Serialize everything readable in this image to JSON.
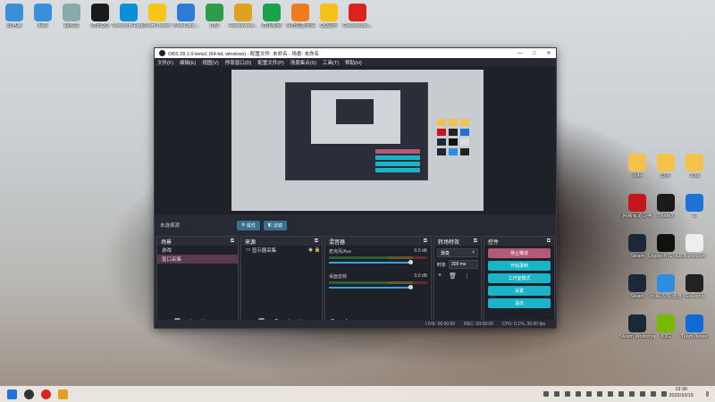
{
  "desktop_icons": [
    {
      "label": "此电脑",
      "icon": "pc-icon",
      "color": "#3a8fd9"
    },
    {
      "label": "网络",
      "icon": "network-icon",
      "color": "#3a8fd9"
    },
    {
      "label": "回收站",
      "icon": "recycle-bin-icon",
      "color": "#8aa"
    },
    {
      "label": "腾讯QQ",
      "icon": "qq-icon",
      "color": "#1b1b1b"
    },
    {
      "label": "Microsoft Edge",
      "icon": "edge-icon",
      "color": "#0c8fd8"
    },
    {
      "label": "TeamViewer",
      "icon": "teamviewer-icon",
      "color": "#f5c518"
    },
    {
      "label": "WiseCare...",
      "icon": "wisecare-icon",
      "color": "#2d7bd6"
    },
    {
      "label": "IDM",
      "icon": "idm-icon",
      "color": "#2e9b4a"
    },
    {
      "label": "Honeyview...",
      "icon": "honeyview-icon",
      "color": "#e0a020"
    },
    {
      "label": "腾讯视频",
      "icon": "tencent-video-icon",
      "color": "#1aa34a"
    },
    {
      "label": "斗鱼直播伴侣",
      "icon": "douyu-icon",
      "color": "#f07a1e"
    },
    {
      "label": "QQ音乐",
      "icon": "qq-music-icon",
      "color": "#f2c21b"
    },
    {
      "label": "CloudMusic...",
      "icon": "cloudmusic-icon",
      "color": "#d8231f"
    }
  ],
  "right_icons": [
    {
      "label": "资料",
      "icon": "folder-icon",
      "color": "#f3c24a"
    },
    {
      "label": "软件",
      "icon": "folder-icon",
      "color": "#f3c24a"
    },
    {
      "label": "文档",
      "icon": "folder-icon",
      "color": "#f3c24a"
    },
    {
      "label": "网易有道词典",
      "icon": "youdao-icon",
      "color": "#c4161c"
    },
    {
      "label": "ShareX",
      "icon": "sharex-icon",
      "color": "#1b1b1b"
    },
    {
      "label": "S",
      "icon": "sogou-icon",
      "color": "#1d73d8"
    },
    {
      "label": "Steam",
      "icon": "steam-icon",
      "color": "#1b2838"
    },
    {
      "label": "Logitech G HUB",
      "icon": "ghub-icon",
      "color": "#111"
    },
    {
      "label": "Bandicam",
      "icon": "bandicam-icon",
      "color": "#eee"
    },
    {
      "label": "Steam",
      "icon": "steam-icon",
      "color": "#1b2838"
    },
    {
      "label": "网易UU加速器",
      "icon": "uu-icon",
      "color": "#2d8de0"
    },
    {
      "label": "GeForce",
      "icon": "geforce-icon",
      "color": "#222"
    },
    {
      "label": "Steam Workshop",
      "icon": "steam-icon",
      "color": "#1b2838"
    },
    {
      "label": "K3G",
      "icon": "nvidia-icon",
      "color": "#76b900"
    },
    {
      "label": "TeamViewer",
      "icon": "teamviewer-icon",
      "color": "#0e6cd8"
    }
  ],
  "obs": {
    "title": "OBS 28.1.0-beta1 (64-bit, windows) - 配置文件: 未命名 - 场景: 未命名",
    "menu": [
      "文件(F)",
      "编辑(E)",
      "视图(V)",
      "停靠窗口(D)",
      "配置文件(P)",
      "场景集合(S)",
      "工具(T)",
      "帮助(H)"
    ],
    "no_source": "未选择源",
    "props_btn": "属性",
    "filters_btn": "滤镜",
    "scenes": {
      "title": "场景",
      "items": [
        "游戏",
        "窗口采集"
      ],
      "active": 1
    },
    "sources": {
      "title": "来源",
      "items": [
        "显示器采集"
      ]
    },
    "mixer": {
      "title": "混音器",
      "channels": [
        {
          "name": "麦克风/Aux",
          "db": "0.0 dB"
        },
        {
          "name": "桌面音频",
          "db": "0.0 dB"
        }
      ]
    },
    "transitions": {
      "title": "转场特效",
      "type": "渐变",
      "duration_label": "时长",
      "duration": "300 ms"
    },
    "controls": {
      "title": "控件",
      "buttons": [
        "停止推流",
        "开始录制",
        "工作室模式",
        "设置",
        "退出"
      ]
    },
    "status": {
      "live": "LIVE: 00:00:00",
      "rec": "REC: 00:00:00",
      "cpu": "CPU: 0.1%, 30.00 fps"
    }
  },
  "taskbar": {
    "time": "19:36",
    "date": "2022/10/15"
  },
  "colors": {
    "accent": "#1ab3c7",
    "stop": "#b45a76",
    "window_bg": "#272a33"
  }
}
